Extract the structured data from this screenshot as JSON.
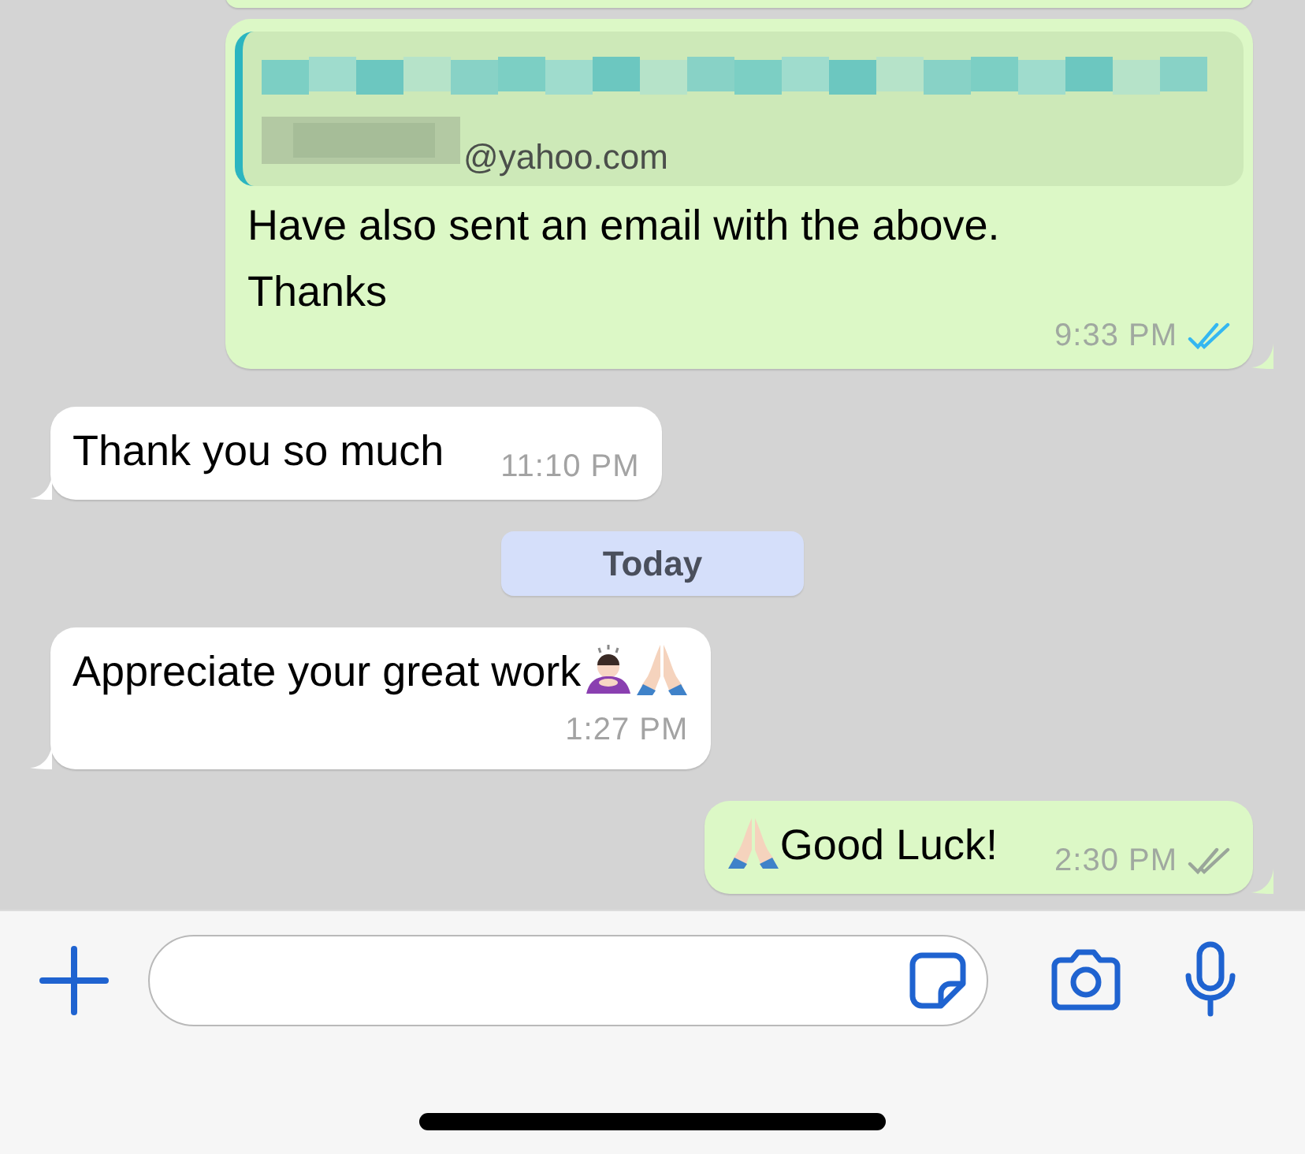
{
  "messages": [
    {
      "kind": "cut",
      "outgoing": true
    },
    {
      "kind": "quoted",
      "outgoing": true,
      "quote": {
        "visible_text": "@yahoo.com"
      },
      "text": "Have also sent an email with the above. Thanks",
      "time": "9:33 PM",
      "read": true
    },
    {
      "kind": "text",
      "outgoing": false,
      "text": "Thank you so much",
      "time": "11:10 PM",
      "time_inline": true
    },
    {
      "kind": "date",
      "text": "Today"
    },
    {
      "kind": "text",
      "outgoing": false,
      "text": "Appreciate your great work",
      "emoji": [
        {
          "kind": "bowing"
        },
        {
          "kind": "praying"
        }
      ],
      "time": "1:27 PM",
      "time_inline": false
    },
    {
      "kind": "text",
      "outgoing": true,
      "emoji_before": [
        {
          "kind": "praying"
        }
      ],
      "text": "Good Luck!",
      "time": "2:30 PM",
      "time_inline": true,
      "read": false
    }
  ]
}
